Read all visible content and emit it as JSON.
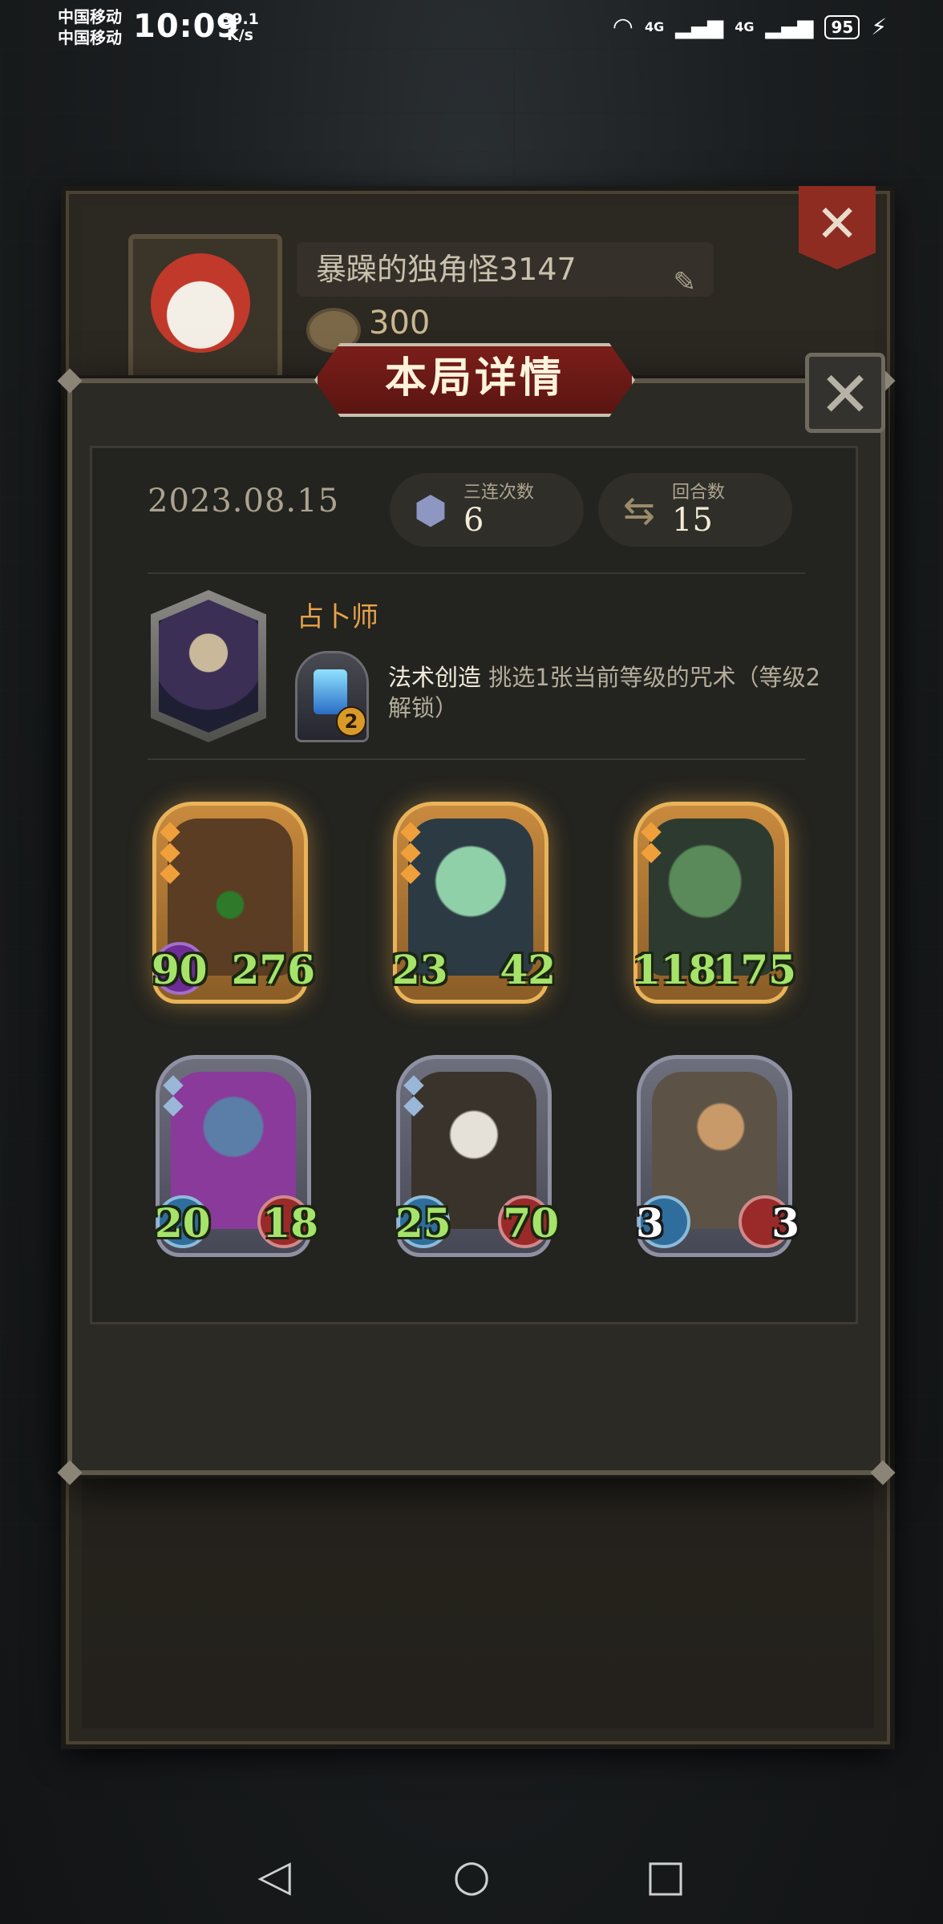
{
  "status_bar": {
    "carrier_1": "中国移动",
    "carrier_2": "中国移动",
    "time": "10:09",
    "speed_value": "39.1",
    "speed_unit": "K/s",
    "network_1": "4G",
    "network_2": "4G",
    "battery": "95"
  },
  "profile": {
    "name": "暴躁的独角怪3147",
    "coins": "300",
    "avatar_icon": "red-hood-girl-avatar",
    "close_icon": "close-icon"
  },
  "modal": {
    "title": "本局详情",
    "date": "2023.08.15",
    "stats": [
      {
        "label": "三连次数",
        "value": "6",
        "icon": "triple-merge-icon"
      },
      {
        "label": "回合数",
        "value": "15",
        "icon": "round-cycle-icon"
      }
    ],
    "hero": {
      "name": "占卜师",
      "portrait_icon": "fortune-teller-portrait",
      "skill_name": "法术创造",
      "skill_desc": "挑选1张当前等级的咒术（等级2解锁）",
      "skill_badge": "2"
    },
    "cards": [
      {
        "name": "treant-card",
        "tier": "gold",
        "attack": "90",
        "health": "276",
        "gems": 3
      },
      {
        "name": "goblin-card",
        "tier": "gold",
        "attack": "23",
        "health": "42",
        "gems": 3
      },
      {
        "name": "vulture-card",
        "tier": "gold",
        "attack": "118",
        "health": "175",
        "gems": 2
      },
      {
        "name": "mushroom-spider-card",
        "tier": "gray",
        "attack": "20",
        "health": "18",
        "gems": 2
      },
      {
        "name": "rabbit-mask-card",
        "tier": "gray",
        "attack": "25",
        "health": "70",
        "gems": 2
      },
      {
        "name": "scholar-card",
        "tier": "gray",
        "attack": "3",
        "health": "3",
        "gems": 0
      }
    ]
  },
  "colors": {
    "title_red": "#7b1e1a",
    "hero_name": "#e8a24a",
    "stat_green": "#a6e36a",
    "gold_frame": "#e9b35a"
  }
}
